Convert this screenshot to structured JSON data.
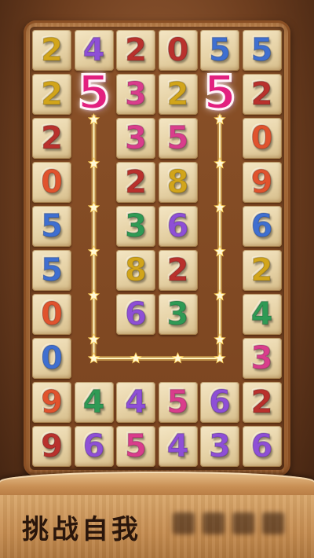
{
  "colors": {
    "yellow": "#d2a51a",
    "purple": "#8e4fd6",
    "red": "#b9312d",
    "pink": "#d93d8c",
    "blue": "#3f6fd0",
    "green": "#2f9a55",
    "orange": "#e0532e",
    "selected": "#e2207f",
    "path": "#fff6c2"
  },
  "board": {
    "rows": [
      [
        {
          "d": "2",
          "c": "yellow"
        },
        {
          "d": "4",
          "c": "purple"
        },
        {
          "d": "2",
          "c": "red"
        },
        {
          "d": "0",
          "c": "red"
        },
        {
          "d": "5",
          "c": "blue"
        },
        {
          "d": "5",
          "c": "blue"
        }
      ],
      [
        {
          "d": "2",
          "c": "yellow"
        },
        {
          "d": "",
          "c": ""
        },
        {
          "d": "3",
          "c": "pink"
        },
        {
          "d": "2",
          "c": "yellow"
        },
        {
          "d": "",
          "c": ""
        },
        {
          "d": "2",
          "c": "red"
        }
      ],
      [
        {
          "d": "2",
          "c": "red"
        },
        {
          "d": "",
          "c": ""
        },
        {
          "d": "3",
          "c": "pink"
        },
        {
          "d": "5",
          "c": "pink"
        },
        {
          "d": "",
          "c": ""
        },
        {
          "d": "0",
          "c": "orange"
        }
      ],
      [
        {
          "d": "0",
          "c": "orange"
        },
        {
          "d": "",
          "c": ""
        },
        {
          "d": "2",
          "c": "red"
        },
        {
          "d": "8",
          "c": "yellow"
        },
        {
          "d": "",
          "c": ""
        },
        {
          "d": "9",
          "c": "orange"
        }
      ],
      [
        {
          "d": "5",
          "c": "blue"
        },
        {
          "d": "",
          "c": ""
        },
        {
          "d": "3",
          "c": "green"
        },
        {
          "d": "6",
          "c": "purple"
        },
        {
          "d": "",
          "c": ""
        },
        {
          "d": "6",
          "c": "blue"
        }
      ],
      [
        {
          "d": "5",
          "c": "blue"
        },
        {
          "d": "",
          "c": ""
        },
        {
          "d": "8",
          "c": "yellow"
        },
        {
          "d": "2",
          "c": "red"
        },
        {
          "d": "",
          "c": ""
        },
        {
          "d": "2",
          "c": "yellow"
        }
      ],
      [
        {
          "d": "0",
          "c": "orange"
        },
        {
          "d": "",
          "c": ""
        },
        {
          "d": "6",
          "c": "purple"
        },
        {
          "d": "3",
          "c": "green"
        },
        {
          "d": "",
          "c": ""
        },
        {
          "d": "4",
          "c": "green"
        }
      ],
      [
        {
          "d": "0",
          "c": "blue"
        },
        {
          "d": "",
          "c": ""
        },
        {
          "d": "",
          "c": ""
        },
        {
          "d": "",
          "c": ""
        },
        {
          "d": "",
          "c": ""
        },
        {
          "d": "3",
          "c": "pink"
        }
      ],
      [
        {
          "d": "9",
          "c": "orange"
        },
        {
          "d": "4",
          "c": "green"
        },
        {
          "d": "4",
          "c": "purple"
        },
        {
          "d": "5",
          "c": "pink"
        },
        {
          "d": "6",
          "c": "purple"
        },
        {
          "d": "2",
          "c": "red"
        }
      ],
      [
        {
          "d": "9",
          "c": "red"
        },
        {
          "d": "6",
          "c": "purple"
        },
        {
          "d": "5",
          "c": "pink"
        },
        {
          "d": "4",
          "c": "purple"
        },
        {
          "d": "3",
          "c": "purple"
        },
        {
          "d": "6",
          "c": "purple"
        }
      ]
    ]
  },
  "selection": {
    "left_digit": "5",
    "right_digit": "5",
    "left_cell": [
      1,
      1
    ],
    "right_cell": [
      1,
      4
    ],
    "path_icon": "star-icon"
  },
  "banner": {
    "title": "挑战自我"
  }
}
